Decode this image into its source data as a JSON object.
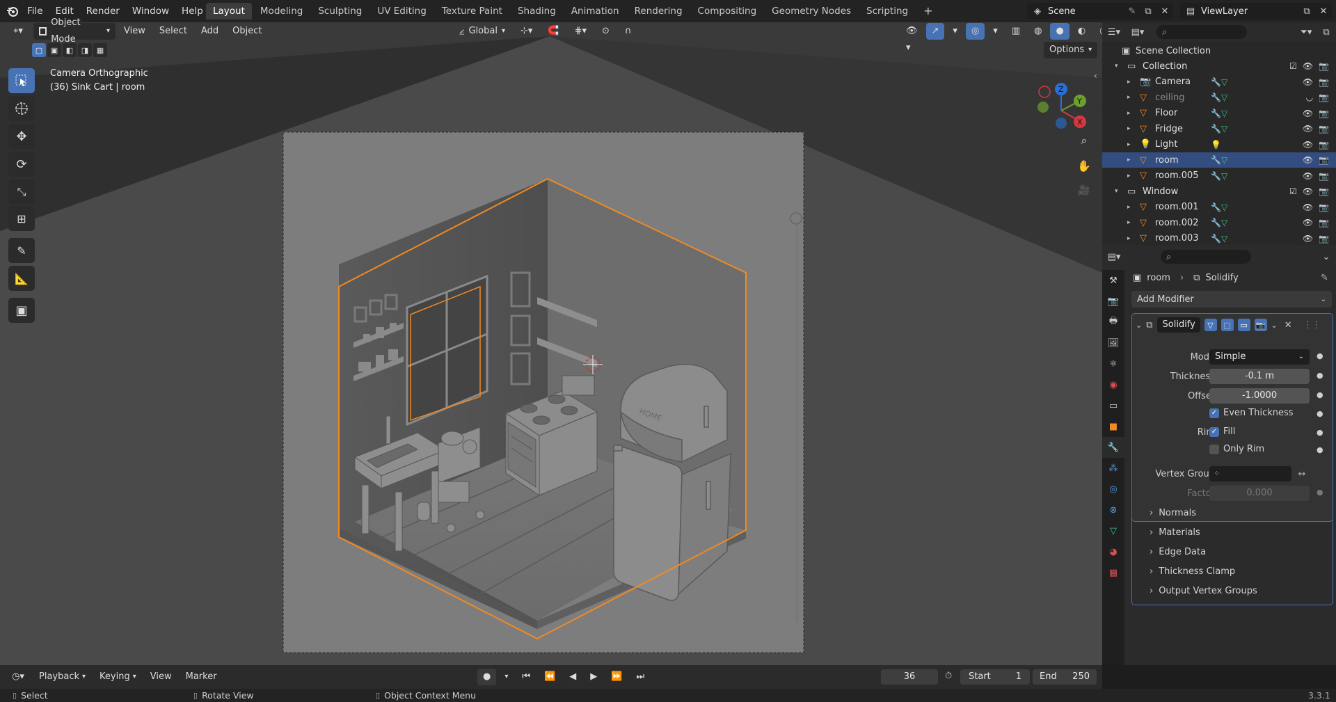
{
  "app": {
    "logo": "blender-icon",
    "version": "3.3.1"
  },
  "menu": [
    "File",
    "Edit",
    "Render",
    "Window",
    "Help"
  ],
  "workspaces": [
    "Layout",
    "Modeling",
    "Sculpting",
    "UV Editing",
    "Texture Paint",
    "Shading",
    "Animation",
    "Rendering",
    "Compositing",
    "Geometry Nodes",
    "Scripting"
  ],
  "active_workspace": "Layout",
  "scene": {
    "label": "Scene",
    "view_layer": "ViewLayer"
  },
  "viewport_header": {
    "mode": "Object Mode",
    "menus": [
      "View",
      "Select",
      "Add",
      "Object"
    ],
    "orientation": "Global",
    "options": "Options"
  },
  "viewport": {
    "camera_label": "Camera Orthographic",
    "object_label": "(36) Sink Cart | room",
    "fridge_text": "HOME",
    "accent_color": "#f08a24",
    "background": "#3a3a3a"
  },
  "outliner": {
    "scene_collection": "Scene Collection",
    "items": [
      {
        "name": "Collection",
        "level": 1,
        "type": "collection"
      },
      {
        "name": "Camera",
        "level": 2,
        "type": "camera"
      },
      {
        "name": "ceiling",
        "level": 2,
        "type": "mesh",
        "dim": true
      },
      {
        "name": "Floor",
        "level": 2,
        "type": "mesh"
      },
      {
        "name": "Fridge",
        "level": 2,
        "type": "mesh"
      },
      {
        "name": "Light",
        "level": 2,
        "type": "light"
      },
      {
        "name": "room",
        "level": 2,
        "type": "mesh",
        "selected": true
      },
      {
        "name": "room.005",
        "level": 2,
        "type": "mesh"
      },
      {
        "name": "Window",
        "level": 1,
        "type": "collection"
      },
      {
        "name": "room.001",
        "level": 2,
        "type": "mesh"
      },
      {
        "name": "room.002",
        "level": 2,
        "type": "mesh"
      },
      {
        "name": "room.003",
        "level": 2,
        "type": "mesh"
      }
    ]
  },
  "properties": {
    "breadcrumb_object": "room",
    "breadcrumb_modifier": "Solidify",
    "add_modifier": "Add Modifier",
    "modifier_name": "Solidify",
    "mode_label": "Mode",
    "mode_value": "Simple",
    "thickness_label": "Thickness",
    "thickness_value": "-0.1 m",
    "offset_label": "Offset",
    "offset_value": "-1.0000",
    "even_thickness": "Even Thickness",
    "rim_label": "Rim",
    "fill": "Fill",
    "only_rim": "Only Rim",
    "vertex_group_label": "Vertex Group",
    "factor_label": "Factor",
    "factor_value": "0.000",
    "subpanels": [
      "Normals",
      "Materials",
      "Edge Data",
      "Thickness Clamp",
      "Output Vertex Groups"
    ]
  },
  "timeline": {
    "menus": [
      "Playback",
      "Keying",
      "View",
      "Marker"
    ],
    "current_frame": "36",
    "start_label": "Start",
    "start_value": "1",
    "end_label": "End",
    "end_value": "250"
  },
  "status": {
    "select": "Select",
    "rotate": "Rotate View",
    "context": "Object Context Menu"
  }
}
